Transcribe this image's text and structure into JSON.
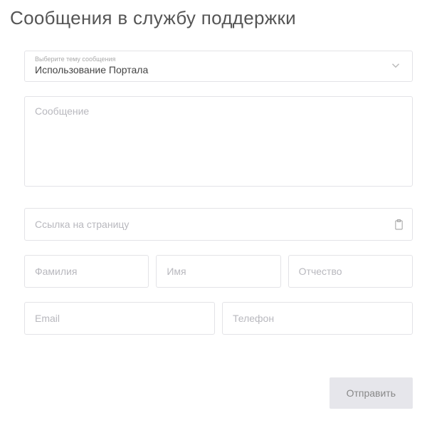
{
  "page": {
    "title": "Сообщения в службу поддержки"
  },
  "form": {
    "topic": {
      "label": "Выберите тему сообщения",
      "value": "Использование Портала"
    },
    "message": {
      "placeholder": "Сообщение"
    },
    "url": {
      "placeholder": "Ссылка на страницу"
    },
    "lastname": {
      "placeholder": "Фамилия"
    },
    "firstname": {
      "placeholder": "Имя"
    },
    "patronymic": {
      "placeholder": "Отчество"
    },
    "email": {
      "placeholder": "Email"
    },
    "phone": {
      "placeholder": "Телефон"
    },
    "submit": {
      "label": "Отправить"
    }
  }
}
